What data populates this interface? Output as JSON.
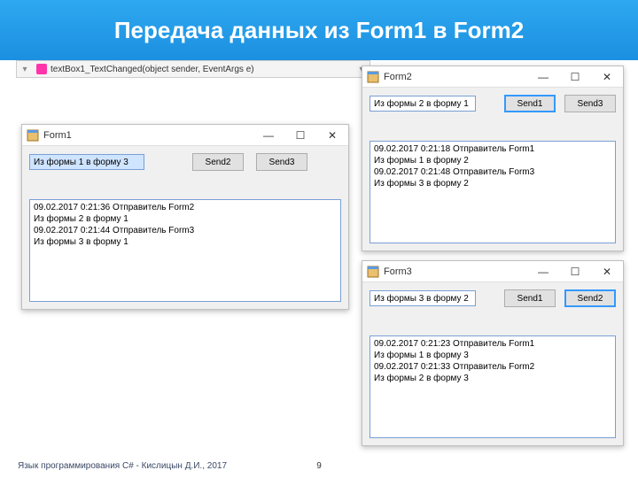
{
  "slide": {
    "title": "Передача данных из Form1 в Form2",
    "footer_text": "Язык программирования C# - Кислицын Д.И., 2017",
    "page_number": "9"
  },
  "vs_bar": {
    "method": "textBox1_TextChanged(object sender, EventArgs e)"
  },
  "form1": {
    "title": "Form1",
    "input_value": "Из формы 1 в форму 3",
    "btn_a": "Send2",
    "btn_b": "Send3",
    "log": "09.02.2017 0:21:36  Отправитель Form2\nИз формы 2 в форму 1\n09.02.2017 0:21:44  Отправитель Form3\nИз формы 3 в форму 1"
  },
  "form2": {
    "title": "Form2",
    "input_value": "Из формы 2 в форму 1",
    "btn_a": "Send1",
    "btn_b": "Send3",
    "log": "09.02.2017 0:21:18  Отправитель Form1\nИз формы 1 в форму 2\n09.02.2017 0:21:48  Отправитель Form3\nИз формы 3 в форму 2"
  },
  "form3": {
    "title": "Form3",
    "input_value": "Из формы 3 в форму 2",
    "btn_a": "Send1",
    "btn_b": "Send2",
    "log": "09.02.2017 0:21:23  Отправитель Form1\nИз формы 1 в форму 3\n09.02.2017 0:21:33  Отправитель Form2\nИз формы 2 в форму 3"
  }
}
